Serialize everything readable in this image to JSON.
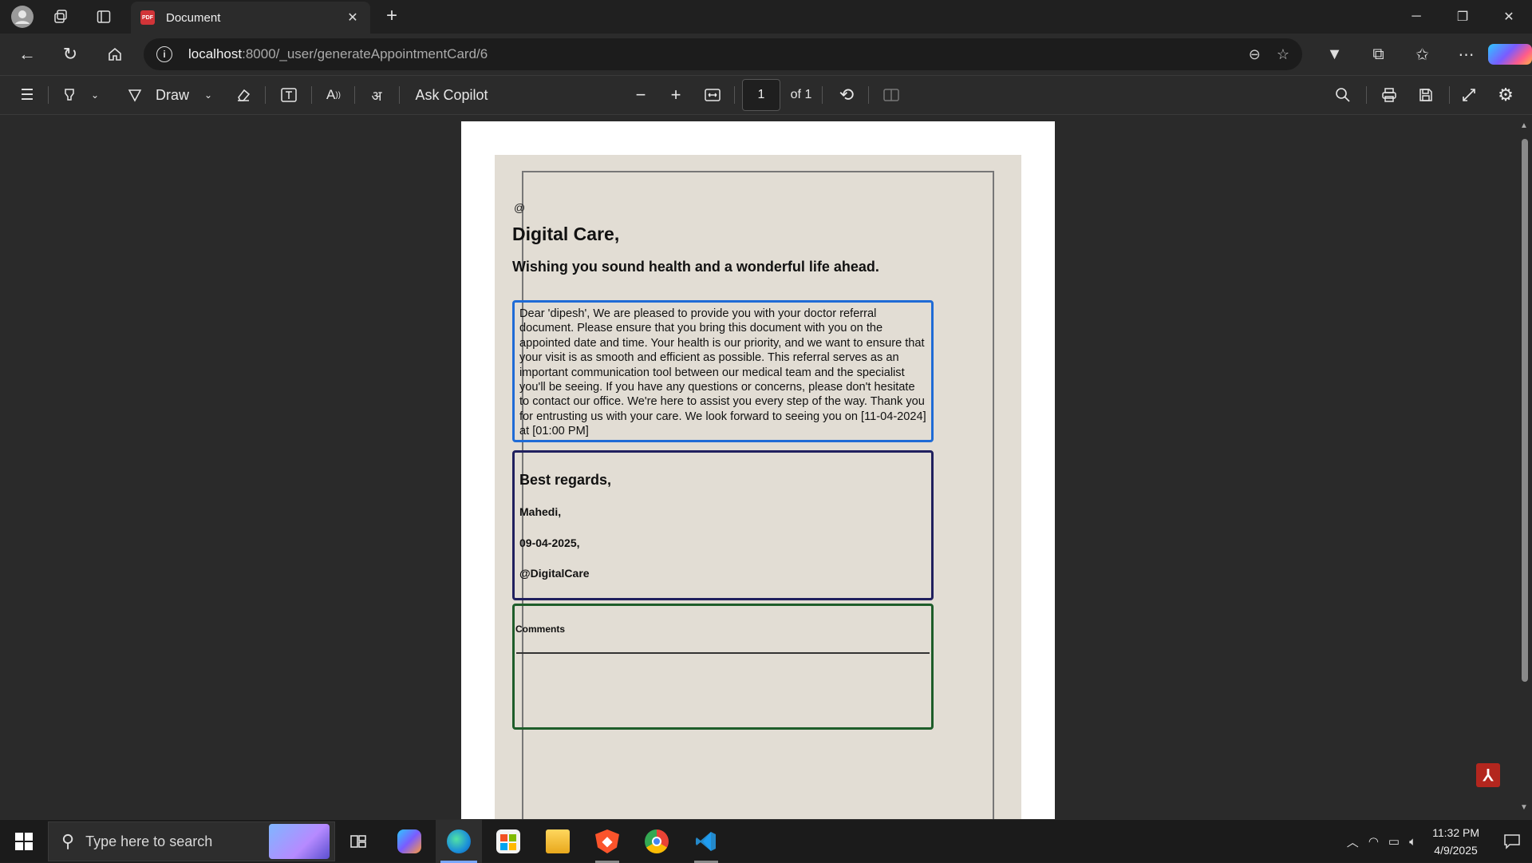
{
  "browser": {
    "tab_title": "Document",
    "tab_favicon": "PDF",
    "url_host": "localhost",
    "url_rest": ":8000/_user/generateAppointmentCard/6"
  },
  "pdf_toolbar": {
    "draw_label": "Draw",
    "ask_copilot_label": "Ask Copilot",
    "page_number": "1",
    "page_total": "of 1"
  },
  "document": {
    "at_symbol": "@",
    "title": "Digital Care,",
    "subtitle": "Wishing you sound health and a wonderful life ahead.",
    "message": "Dear 'dipesh', We are pleased to provide you with your doctor referral document. Please ensure that you bring this document with you on the appointed date and time. Your health is our priority, and we want to ensure that your visit is as smooth and efficient as possible. This referral serves as an important communication tool between our medical team and the specialist you'll be seeing. If you have any questions or concerns, please don't hesitate to contact our office. We're here to assist you every step of the way. Thank you for entrusting us with your care. We look forward to seeing you on [11-04-2024] at [01:00 PM]",
    "regards": {
      "line1": "Best regards,",
      "line2": "Mahedi,",
      "line3": "09-04-2025,",
      "line4": "@DigitalCare"
    },
    "comments_label": "Comments"
  },
  "taskbar": {
    "search_placeholder": "Type here to search",
    "time": "11:32 PM",
    "date": "4/9/2025"
  },
  "colors": {
    "message_border": "#1f6bd6",
    "regards_border": "#20205e",
    "comments_border": "#1e5d2a",
    "card_background": "#e2ddd4"
  }
}
